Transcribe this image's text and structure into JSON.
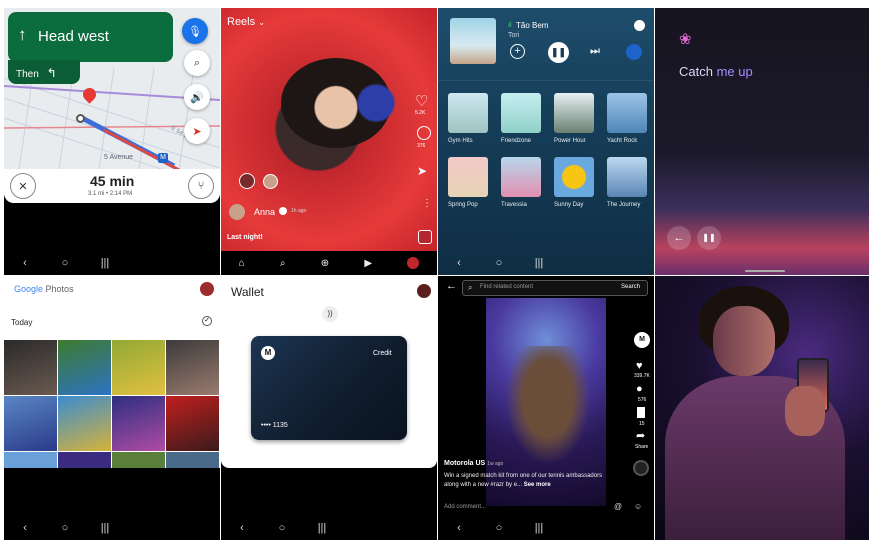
{
  "nav": {
    "back": "‹",
    "home": "○",
    "recents": "|||"
  },
  "maps": {
    "direction": "Head west",
    "then_label": "Then",
    "street": "5 Avenue",
    "street_short": "E 54 St",
    "eta": "45 min",
    "details": "3.1 mi • 2:14 PM"
  },
  "reels": {
    "title": "Reels",
    "user": "Anna",
    "time_ago": "1h ago",
    "caption": "Last night!",
    "like_count": "5.2K",
    "comment_count": "376"
  },
  "music": {
    "now_playing_title": "Tão Bem",
    "now_playing_artist": "Tori",
    "playlists": [
      "Gym Hits",
      "Friendzone",
      "Power Hour",
      "Yacht Rock",
      "Spring Pop",
      "Travessia",
      "Sunny Day",
      "The Journey"
    ]
  },
  "assistant": {
    "prompt_word1": "Catch",
    "prompt_word2": "me up"
  },
  "photos": {
    "brand_google": "Google",
    "brand_photos": "Photos",
    "section": "Today"
  },
  "wallet": {
    "title": "Wallet",
    "card_type": "Credit",
    "card_number": "•••• 1135"
  },
  "tiktok": {
    "search_placeholder": "Find related content",
    "search_button": "Search",
    "username": "Motorola US",
    "time_ago": "1w ago",
    "caption": "Win a signed match kit from one of our tennis ambassadors along with a new #razr by e...",
    "see_more": "See more",
    "like_count": "339.7K",
    "comment_count": "576",
    "save_count": "15",
    "share_label": "Share",
    "add_comment": "Add comment..."
  },
  "colors": {
    "maps_green": "#0b6c3d",
    "reels_red": "#e63a3a",
    "music_blue": "#163e59",
    "assistant_purple": "#8a6cff",
    "wallet_card": "#1c3552"
  }
}
